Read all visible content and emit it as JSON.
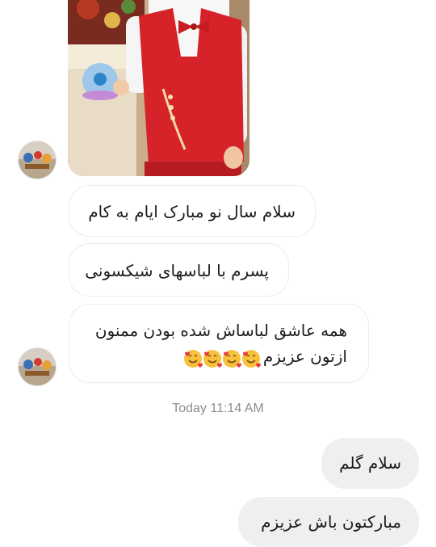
{
  "conversation": {
    "incoming": [
      {
        "text": "سلام سال نو مبارک ایام به کام"
      },
      {
        "text": "پسرم با لباسهای شیکسونی"
      },
      {
        "line1": "همه عاشق لباساش شده بودن ممنون",
        "line2": "ازتون عزیزم",
        "emojis": [
          "smiling-face-with-hearts",
          "smiling-face-with-hearts",
          "smiling-face-with-hearts",
          "smiling-face-with-hearts"
        ]
      }
    ],
    "timestamp": "Today 11:14 AM",
    "outgoing": [
      {
        "text": "سلام گلم"
      },
      {
        "text": "مبارکتون باش عزیزم"
      }
    ]
  },
  "colors": {
    "incoming_bubble_bg": "#ffffff",
    "incoming_bubble_border": "#ececec",
    "outgoing_bubble_bg": "#efefef",
    "timestamp": "#8e8e8e",
    "vest_red": "#d62229",
    "emoji_yellow": "#f7c13c"
  }
}
